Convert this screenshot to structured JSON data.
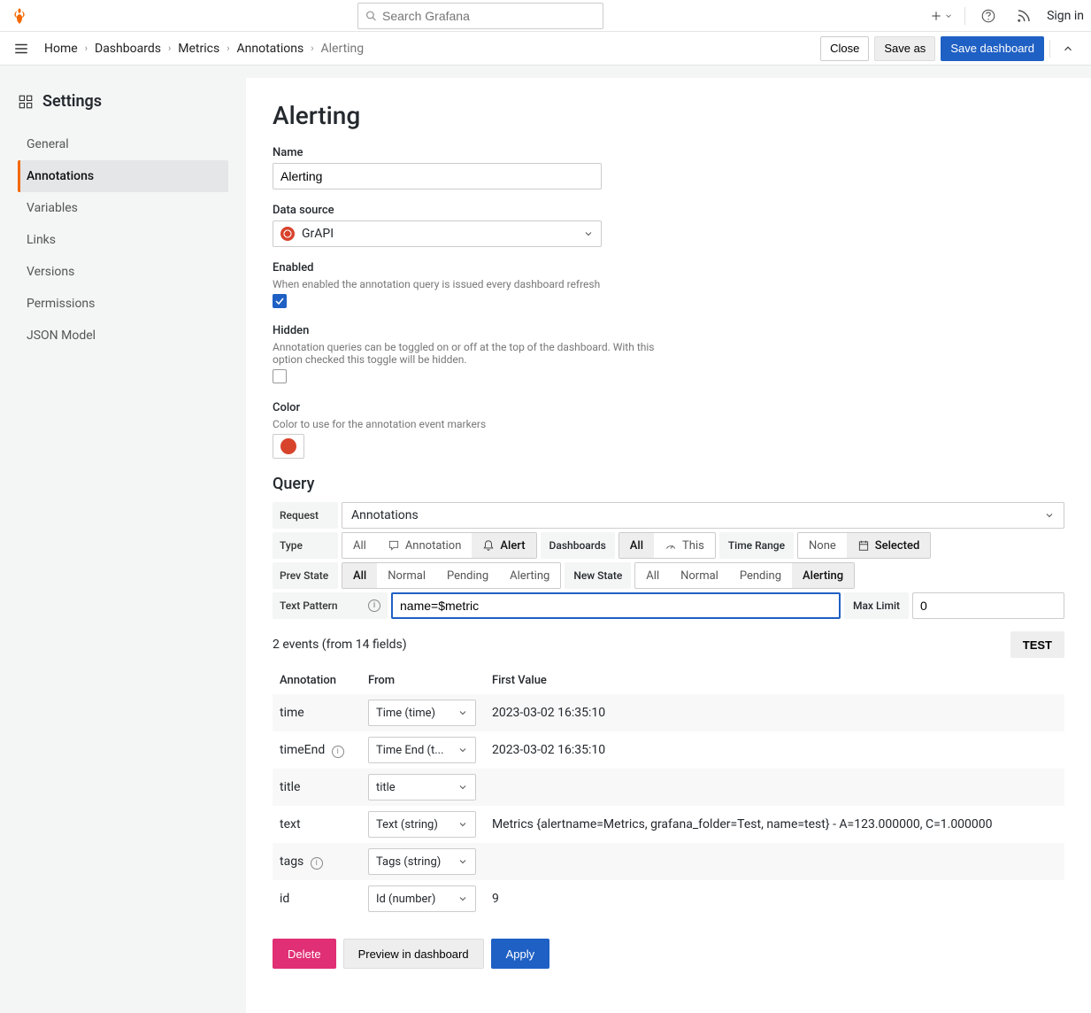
{
  "topbar": {
    "search_placeholder": "Search Grafana",
    "signin": "Sign in"
  },
  "breadcrumbs": [
    "Home",
    "Dashboards",
    "Metrics",
    "Annotations",
    "Alerting"
  ],
  "nav_actions": {
    "close": "Close",
    "save_as": "Save as",
    "save_dashboard": "Save dashboard"
  },
  "sidebar": {
    "title": "Settings",
    "items": [
      "General",
      "Annotations",
      "Variables",
      "Links",
      "Versions",
      "Permissions",
      "JSON Model"
    ],
    "active_index": 1
  },
  "page": {
    "title": "Alerting",
    "name": {
      "label": "Name",
      "value": "Alerting"
    },
    "datasource": {
      "label": "Data source",
      "value": "GrAPI"
    },
    "enabled": {
      "label": "Enabled",
      "desc": "When enabled the annotation query is issued every dashboard refresh",
      "checked": true
    },
    "hidden": {
      "label": "Hidden",
      "desc": "Annotation queries can be toggled on or off at the top of the dashboard. With this option checked this toggle will be hidden.",
      "checked": false
    },
    "color": {
      "label": "Color",
      "desc": "Color to use for the annotation event markers",
      "value": "#d8432c"
    },
    "query_title": "Query",
    "request": {
      "label": "Request",
      "value": "Annotations"
    },
    "type": {
      "label": "Type",
      "options": [
        "All",
        "Annotation",
        "Alert"
      ],
      "active": 2
    },
    "dashboards": {
      "label": "Dashboards",
      "options": [
        "All",
        "This"
      ],
      "active": 0
    },
    "timerange": {
      "label": "Time Range",
      "options": [
        "None",
        "Selected"
      ],
      "active": 1
    },
    "prevstate": {
      "label": "Prev State",
      "options": [
        "All",
        "Normal",
        "Pending",
        "Alerting"
      ],
      "active": 0
    },
    "newstate": {
      "label": "New State",
      "options": [
        "All",
        "Normal",
        "Pending",
        "Alerting"
      ],
      "active": 3
    },
    "textpattern": {
      "label": "Text Pattern",
      "value": "name=$metric"
    },
    "maxlimit": {
      "label": "Max Limit",
      "value": "0"
    },
    "events_text": "2 events (from 14 fields)",
    "test_label": "TEST",
    "table": {
      "headers": [
        "Annotation",
        "From",
        "First Value"
      ],
      "rows": [
        {
          "annotation": "time",
          "from": "Time (time)",
          "value": "2023-03-02 16:35:10",
          "info": false
        },
        {
          "annotation": "timeEnd",
          "from": "Time End (t...",
          "value": "2023-03-02 16:35:10",
          "info": true
        },
        {
          "annotation": "title",
          "from": "title",
          "value": "",
          "info": false
        },
        {
          "annotation": "text",
          "from": "Text (string)",
          "value": "Metrics {alertname=Metrics, grafana_folder=Test, name=test} - A=123.000000, C=1.000000",
          "info": false
        },
        {
          "annotation": "tags",
          "from": "Tags (string)",
          "value": "",
          "info": true
        },
        {
          "annotation": "id",
          "from": "Id (number)",
          "value": "9",
          "info": false
        }
      ]
    },
    "actions": {
      "delete": "Delete",
      "preview": "Preview in dashboard",
      "apply": "Apply"
    }
  }
}
